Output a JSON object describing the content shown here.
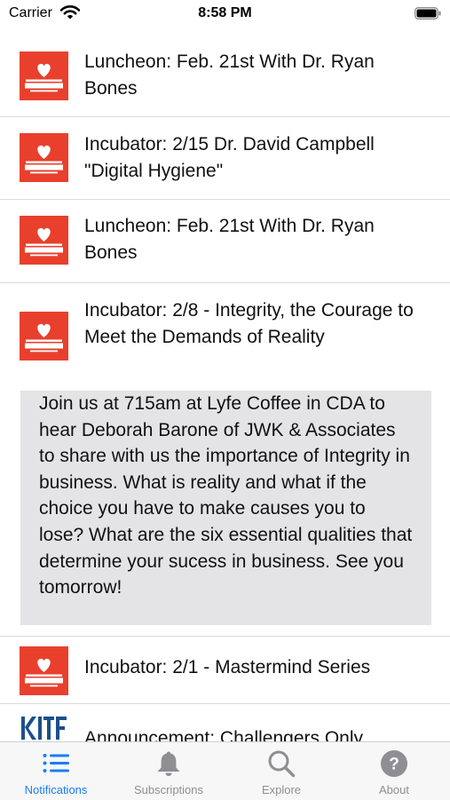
{
  "status_bar": {
    "carrier": "Carrier",
    "time": "8:58 PM"
  },
  "feed": {
    "items": [
      {
        "title": "Luncheon: Feb. 21st With Dr. Ryan Bones",
        "logo": "heart-of-business-logo"
      },
      {
        "title": "Incubator: 2/15 Dr. David Campbell \"Digital Hygiene\"",
        "logo": "heart-of-business-logo"
      },
      {
        "title": "Luncheon: Feb. 21st With Dr. Ryan Bones",
        "logo": "heart-of-business-logo"
      },
      {
        "title": "Incubator: 2/8 - Integrity, the Courage to Meet the Demands of Reality",
        "logo": "heart-of-business-logo",
        "detail": "Join us at 715am at Lyfe Coffee in CDA to hear Deborah Barone of JWK & Associates to share with us the importance of Integrity in business. What is reality and what if the choice you have to make causes you to lose? What are the six essential qualities that determine your sucess in business. See you tomorrow!"
      },
      {
        "title": "Incubator: 2/1 - Mastermind Series",
        "logo": "heart-of-business-logo"
      },
      {
        "title": "Announcement: Challengers Only",
        "logo": "kitefit-logo"
      }
    ]
  },
  "tab_bar": {
    "tabs": [
      {
        "label": "Notifications",
        "icon": "list-icon",
        "active": true
      },
      {
        "label": "Subscriptions",
        "icon": "bell-icon",
        "active": false
      },
      {
        "label": "Explore",
        "icon": "search-icon",
        "active": false
      },
      {
        "label": "About",
        "icon": "help-icon",
        "active": false
      }
    ]
  },
  "colors": {
    "accent": "#1a7cf6",
    "brand": "#e8402c",
    "inactive": "#8e8e93",
    "detail_bg": "#e4e4e6"
  }
}
